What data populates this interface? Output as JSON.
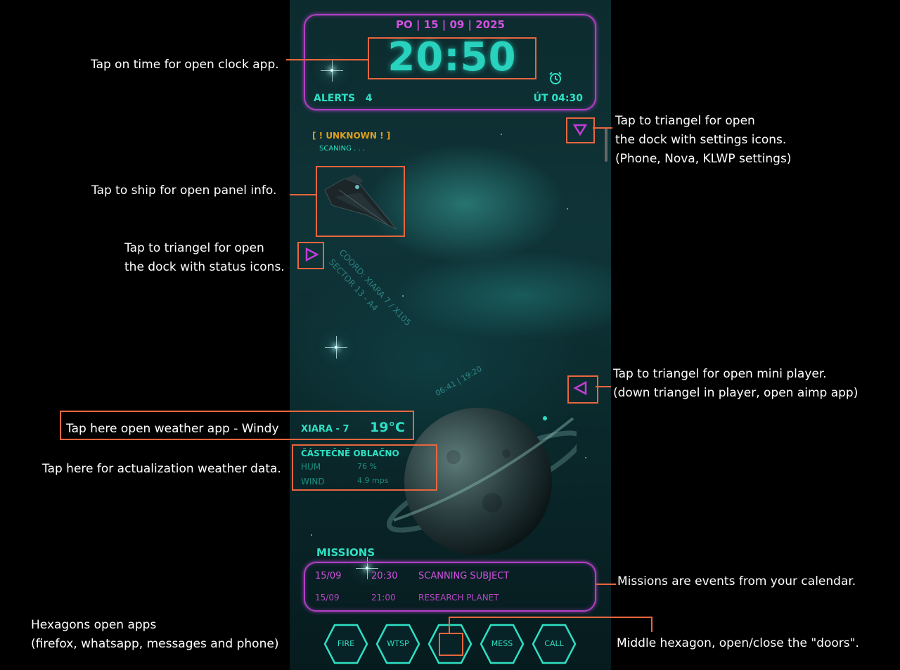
{
  "widget": {
    "date": "PO | 15 | 09 | 2025",
    "time": "20:50",
    "alerts_label": "ALERTS",
    "alerts_count": "4",
    "next_alarm": "ÚT 04:30"
  },
  "ship_panel": {
    "status": "[ ! UNKNOWN ! ]",
    "scan": "SCANING . . ."
  },
  "coordinates": {
    "line1": "COORD: XIARA 7 / X105",
    "line2": "SECTOR 13 - A4"
  },
  "planet_times": "06:41 | 19:20",
  "weather": {
    "location": "XIARA - 7",
    "temperature": "19°C",
    "condition": "ČÁSTEČNĚ OBLAČNO",
    "hum_label": "HUM",
    "hum_value": "76 %",
    "wind_label": "WIND",
    "wind_value": "4.9 mps"
  },
  "missions": {
    "title": "MISSIONS",
    "items": [
      {
        "date": "15/09",
        "time": "20:30",
        "name": "SCANNING SUBJECT"
      },
      {
        "date": "15/09",
        "time": "21:00",
        "name": "RESEARCH PLANET"
      }
    ]
  },
  "dock": {
    "hexagons": [
      {
        "label": "FIRE"
      },
      {
        "label": "WTSP"
      },
      {
        "label": ""
      },
      {
        "label": "MESS"
      },
      {
        "label": "CALL"
      }
    ]
  },
  "annotations": {
    "clock": "Tap on time for open clock app.",
    "settings_1": "Tap to triangel for open",
    "settings_2": "the dock with settings icons.",
    "settings_3": "(Phone, Nova, KLWP settings)",
    "ship": "Tap to ship for open panel info.",
    "status_1": "Tap to triangel for open",
    "status_2": "the dock with status icons.",
    "player_1": "Tap to triangel for open mini player.",
    "player_2": "(down triangel in player, open aimp app)",
    "weather_app": "Tap here open weather app - Windy",
    "weather_refresh": "Tap here for actualization weather data.",
    "missions": "Missions are events from your calendar.",
    "hexagons_1": "Hexagons open apps",
    "hexagons_2": "(firefox, whatsapp, messages and phone)",
    "doors": "Middle hexagon, open/close the \"doors\"."
  },
  "colors": {
    "accent_cyan": "#2ee0c4",
    "accent_magenta": "#d34fe0",
    "frame_purple": "#b23fc4",
    "annotation_orange": "#e8663e",
    "alert_amber": "#e0a020"
  }
}
